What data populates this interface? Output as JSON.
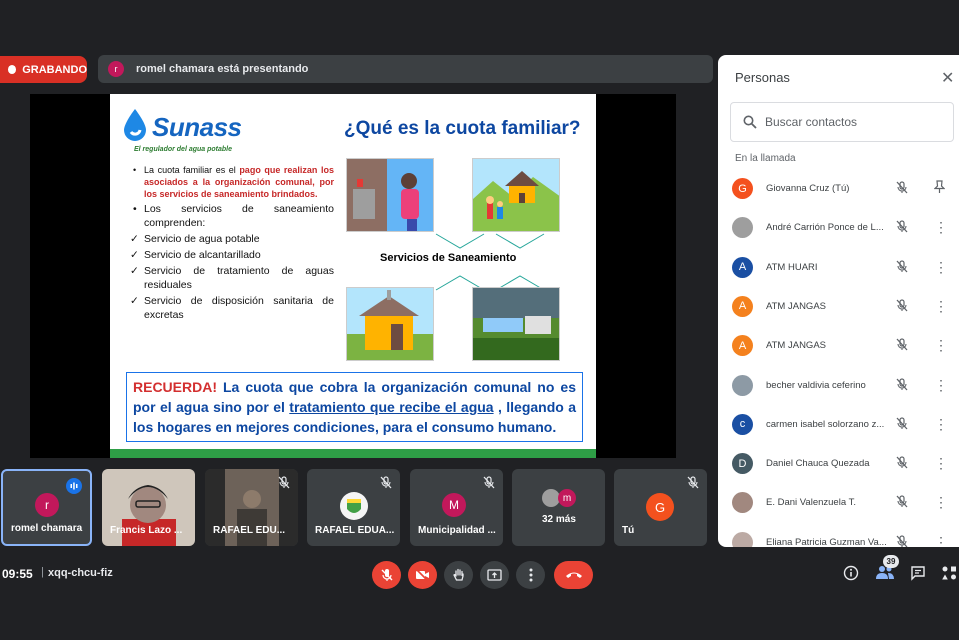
{
  "recording": {
    "label": "GRABANDO"
  },
  "presenting": {
    "avatar_letter": "r",
    "text": "romel chamara está presentando"
  },
  "slide": {
    "brand": "Sunass",
    "tagline": "El regulador del agua potable",
    "title": "¿Qué es la cuota familiar?",
    "bullet1_pre": "La cuota familiar es el ",
    "bullet1_red": "pago que realizan los asociados a la organización comunal, por los servicios de saneamiento brindados.",
    "bullet2": "Los servicios de saneamiento comprenden:",
    "checks": [
      "Servicio de agua potable",
      "Servicio de alcantarillado",
      "Servicio de tratamiento de aguas residuales",
      "Servicio de disposición sanitaria de excretas"
    ],
    "services_label": "Servicios de Saneamiento",
    "notice_red": "RECUERDA!",
    "notice_a": " La cuota que cobra la organización comunal no es por el agua sino por el ",
    "notice_u": "tratamiento que recibe el agua",
    "notice_b": " , llegando a los hogares en mejores condiciones, para el consumo humano."
  },
  "panel": {
    "title": "Personas",
    "search_placeholder": "Buscar contactos",
    "section": "En la llamada",
    "people": [
      {
        "name": "Giovanna Cruz (Tú)",
        "letter": "G",
        "color": "#f4511e",
        "action": "pin"
      },
      {
        "name": "André Carrión Ponce de L...",
        "letter": "",
        "color": "#9e9e9e",
        "action": "more"
      },
      {
        "name": "ATM HUARI",
        "letter": "A",
        "color": "#1a4fa3",
        "action": "more"
      },
      {
        "name": "ATM JANGAS",
        "letter": "A",
        "color": "#f4811e",
        "action": "more"
      },
      {
        "name": "ATM JANGAS",
        "letter": "A",
        "color": "#f4811e",
        "action": "more"
      },
      {
        "name": "becher valdivia ceferino",
        "letter": "",
        "color": "#8d9aa5",
        "action": "more"
      },
      {
        "name": "carmen isabel solorzano z...",
        "letter": "c",
        "color": "#1a4fa3",
        "action": "more"
      },
      {
        "name": "Daniel Chauca Quezada",
        "letter": "D",
        "color": "#455a64",
        "action": "more"
      },
      {
        "name": "E. Dani Valenzuela T.",
        "letter": "",
        "color": "#a1887f",
        "action": "more"
      },
      {
        "name": "Eliana Patricia Guzman Va...",
        "letter": "",
        "color": "#bcaaa4",
        "action": "more"
      }
    ]
  },
  "tiles": [
    {
      "name": "romel chamara",
      "letter": "r"
    },
    {
      "name": "Francis Lazo ..."
    },
    {
      "name": "RAFAEL EDU..."
    },
    {
      "name": "RAFAEL EDUA..."
    },
    {
      "name": "Municipalidad ...",
      "letter": "M"
    },
    {
      "name": "32 más",
      "letter": "m"
    },
    {
      "name": "Tú",
      "letter": "G"
    }
  ],
  "bottom": {
    "time": "09:55",
    "code": "xqq-chcu-fiz",
    "participants_count": "39"
  }
}
